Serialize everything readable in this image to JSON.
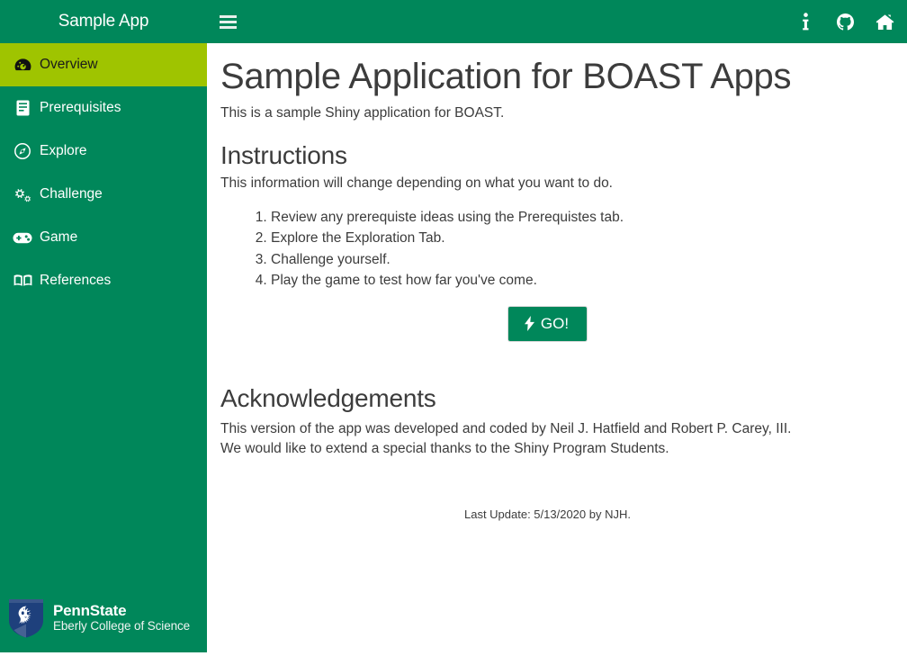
{
  "header": {
    "brand_title": "Sample App",
    "menu_icon": "hamburger-icon",
    "icons": [
      {
        "name": "info-icon",
        "label": "Information"
      },
      {
        "name": "github-icon",
        "label": "GitHub"
      },
      {
        "name": "home-icon",
        "label": "Home"
      }
    ]
  },
  "sidebar": {
    "items": [
      {
        "label": "Overview",
        "icon": "tachometer-icon",
        "active": true
      },
      {
        "label": "Prerequisites",
        "icon": "book-icon",
        "active": false
      },
      {
        "label": "Explore",
        "icon": "compass-icon",
        "active": false
      },
      {
        "label": "Challenge",
        "icon": "gears-icon",
        "active": false
      },
      {
        "label": "Game",
        "icon": "gamepad-icon",
        "active": false
      },
      {
        "label": "References",
        "icon": "book-open-icon",
        "active": false
      }
    ],
    "logo": {
      "name": "PennState",
      "subtitle": "Eberly College of Science",
      "icon": "penn-state-shield-icon"
    }
  },
  "main": {
    "page_title": "Sample Application for BOAST Apps",
    "intro": "This is a sample Shiny application for BOAST.",
    "instructions_heading": "Instructions",
    "instructions_intro": "This information will change depending on what you want to do.",
    "steps": [
      "Review any prerequiste ideas using the Prerequistes tab.",
      "Explore the Exploration Tab.",
      "Challenge yourself.",
      "Play the game to test how far you've come."
    ],
    "go_button": {
      "label": "GO!",
      "icon": "bolt-icon"
    },
    "acknowledgements_heading": "Acknowledgements",
    "acknowledgements": [
      "This version of the app was developed and coded by Neil J. Hatfield and Robert P. Carey, III.",
      "We would like to extend a special thanks to the Shiny Program Students."
    ],
    "last_update": "Last Update: 5/13/2020 by NJH."
  },
  "colors": {
    "brand_green": "#00875a",
    "active_green": "#9fc400",
    "text_dark": "#3c3c3c",
    "shield_navy": "#1e407c"
  }
}
